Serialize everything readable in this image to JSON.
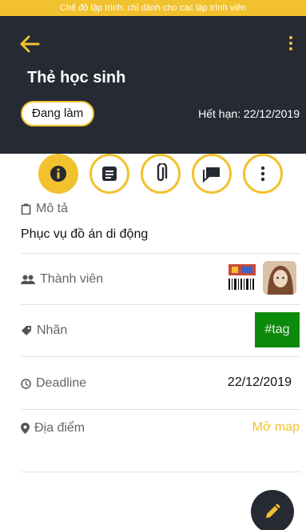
{
  "dev_banner": "Chế độ lập trình: chỉ dành cho các lập trình viên",
  "header": {
    "title": "Thẻ học sinh",
    "status": "Đang làm",
    "expiry": "Hết hạn: 22/12/2019"
  },
  "colors": {
    "accent": "#f2c12e",
    "header_bg": "#262a33",
    "tag_bg": "#0c8a0c"
  },
  "tabs": [
    {
      "icon": "info-icon",
      "active": true
    },
    {
      "icon": "notes-icon",
      "active": false
    },
    {
      "icon": "attachment-icon",
      "active": false
    },
    {
      "icon": "comments-icon",
      "active": false
    },
    {
      "icon": "more-vert-icon",
      "active": false
    }
  ],
  "sections": {
    "description": {
      "label": "Mô tả",
      "value": "Phục vụ đồ án di động"
    },
    "members": {
      "label": "Thành viên"
    },
    "tags": {
      "label": "Nhãn",
      "tag": "#tag"
    },
    "deadline": {
      "label": "Deadline",
      "value": "22/12/2019"
    },
    "location": {
      "label": "Địa điểm",
      "action": "Mở map"
    }
  }
}
